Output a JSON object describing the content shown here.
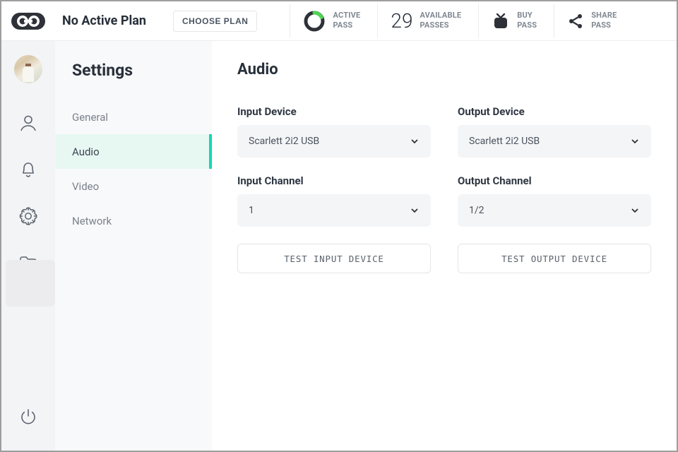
{
  "header": {
    "plan_title": "No Active Plan",
    "choose_plan": "CHOOSE PLAN",
    "active_pass": {
      "line1": "ACTIVE",
      "line2": "PASS"
    },
    "available_passes": {
      "count": "29",
      "line1": "AVAILABLE",
      "line2": "PASSES"
    },
    "buy_pass": {
      "line1": "BUY",
      "line2": "PASS"
    },
    "share_pass": {
      "line1": "SHARE",
      "line2": "PASS"
    }
  },
  "settings": {
    "title": "Settings",
    "items": [
      {
        "label": "General"
      },
      {
        "label": "Audio"
      },
      {
        "label": "Video"
      },
      {
        "label": "Network"
      }
    ]
  },
  "content": {
    "title": "Audio",
    "input_device": {
      "label": "Input Device",
      "value": "Scarlett 2i2 USB"
    },
    "output_device": {
      "label": "Output Device",
      "value": "Scarlett 2i2 USB"
    },
    "input_channel": {
      "label": "Input Channel",
      "value": "1"
    },
    "output_channel": {
      "label": "Output Channel",
      "value": "1/2"
    },
    "test_input": "TEST INPUT DEVICE",
    "test_output": "TEST OUTPUT DEVICE"
  }
}
